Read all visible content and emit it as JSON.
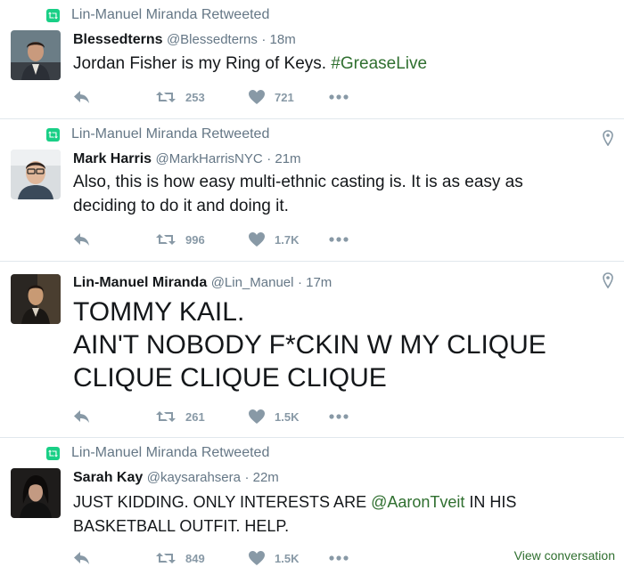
{
  "colors": {
    "accent": "#2f6f2f",
    "retweet_green": "#19cf86",
    "muted": "#657786",
    "icon_gray": "#8899a6"
  },
  "tweets": [
    {
      "retweeted_by": "Lin-Manuel Miranda Retweeted",
      "name": "Blessedterns",
      "handle": "@Blessedterns",
      "time": "· 18m",
      "text_before": "Jordan Fisher is my Ring of Keys.",
      "hashtag": "#GreaseLive",
      "retweets": "253",
      "likes": "721"
    },
    {
      "retweeted_by": "Lin-Manuel Miranda Retweeted",
      "name": "Mark Harris",
      "handle": "@MarkHarrisNYC",
      "time": "· 21m",
      "text": "Also, this is how easy multi-ethnic casting is. It is as easy as deciding to do it and doing it.",
      "retweets": "996",
      "likes": "1.7K"
    },
    {
      "name": "Lin-Manuel Miranda",
      "handle": "@Lin_Manuel",
      "time": "· 17m",
      "line1": "TOMMY KAIL.",
      "line2": "AIN'T NOBODY F*CKIN W MY CLIQUE",
      "line3": "CLIQUE CLIQUE CLIQUE",
      "retweets": "261",
      "likes": "1.5K"
    },
    {
      "retweeted_by": "Lin-Manuel Miranda Retweeted",
      "name": "Sarah Kay",
      "handle": "@kaysarahsera",
      "time": "· 22m",
      "text_before": "JUST KIDDING. ONLY INTERESTS ARE",
      "mention": "@AaronTveit",
      "text_after": "IN HIS BASKETBALL OUTFIT. HELP.",
      "retweets": "849",
      "likes": "1.5K",
      "view_conversation": "View conversation"
    }
  ]
}
